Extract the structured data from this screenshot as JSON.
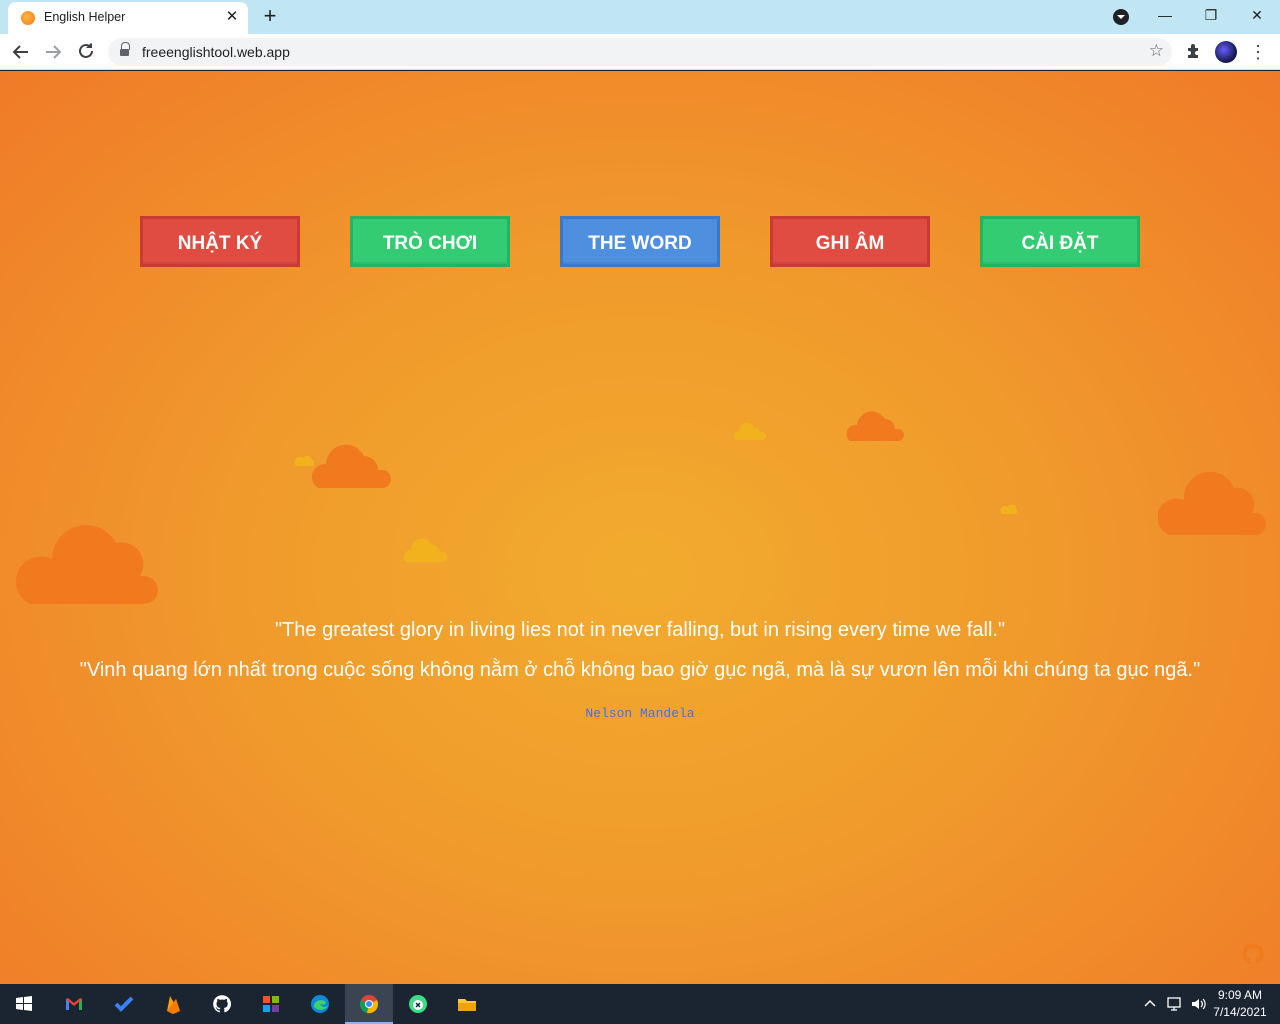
{
  "browser": {
    "tab_title": "English Helper",
    "url": "freeenglishtool.web.app",
    "new_tab_symbol": "+",
    "close_symbol": "✕",
    "minimize_symbol": "—",
    "restore_symbol": "❐",
    "window_close_symbol": "✕"
  },
  "menu": {
    "items": [
      {
        "label": "NHẬT KÝ",
        "color": "#e04c42"
      },
      {
        "label": "TRÒ CHƠI",
        "color": "#33cc72"
      },
      {
        "label": "THE WORD",
        "color": "#4f8fdf"
      },
      {
        "label": "GHI ÂM",
        "color": "#e04c42"
      },
      {
        "label": "CÀI ĐẶT",
        "color": "#33cc72"
      }
    ]
  },
  "quote": {
    "english": "\"The greatest glory in living lies not in never falling, but in rising every time we fall.\"",
    "vietnamese": "\"Vinh quang lớn nhất trong cuộc sống không nằm ở chỗ không bao giờ gục ngã, mà là sự vươn lên mỗi khi chúng ta gục ngã.\"",
    "author": "Nelson Mandela"
  },
  "taskbar": {
    "apps": [
      "start-icon",
      "gmail-icon",
      "todo-icon",
      "firebase-icon",
      "github-icon",
      "office-icon",
      "edge-icon",
      "chrome-icon",
      "android-studio-icon",
      "file-explorer-icon"
    ],
    "time": "9:09 AM",
    "date": "7/14/2021"
  },
  "colors": {
    "background_center": "#f2ab2e",
    "background_edge": "#f07a28",
    "author_color": "#4b6cf0"
  }
}
